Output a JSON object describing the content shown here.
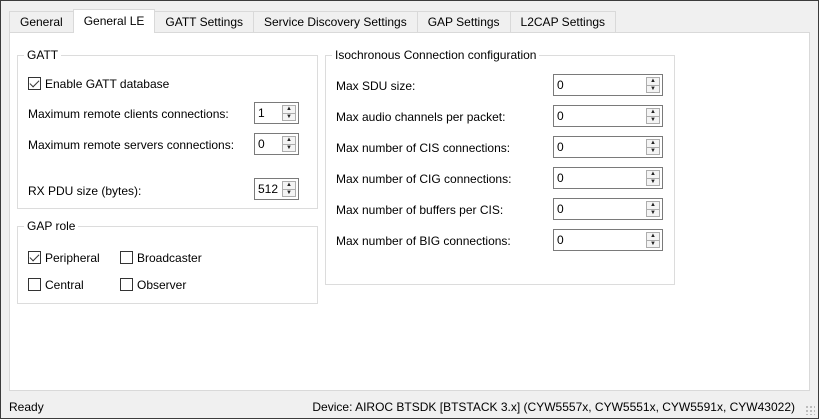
{
  "tabs": [
    {
      "label": "General"
    },
    {
      "label": "General LE"
    },
    {
      "label": "GATT Settings"
    },
    {
      "label": "Service Discovery Settings"
    },
    {
      "label": "GAP Settings"
    },
    {
      "label": "L2CAP Settings"
    }
  ],
  "gatt": {
    "legend": "GATT",
    "enable_label": "Enable GATT database",
    "enable_checked": true,
    "max_clients_label": "Maximum remote clients connections:",
    "max_clients_value": "1",
    "max_servers_label": "Maximum remote servers connections:",
    "max_servers_value": "0",
    "rx_pdu_label": "RX PDU size (bytes):",
    "rx_pdu_value": "512"
  },
  "gap_role": {
    "legend": "GAP role",
    "peripheral": {
      "label": "Peripheral",
      "checked": true
    },
    "broadcaster": {
      "label": "Broadcaster",
      "checked": false
    },
    "central": {
      "label": "Central",
      "checked": false
    },
    "observer": {
      "label": "Observer",
      "checked": false
    }
  },
  "iso": {
    "legend": "Isochronous Connection configuration",
    "fields": [
      {
        "label": "Max SDU size:",
        "value": "0"
      },
      {
        "label": "Max audio channels per packet:",
        "value": "0"
      },
      {
        "label": "Max number of CIS connections:",
        "value": "0"
      },
      {
        "label": "Max number of CIG connections:",
        "value": "0"
      },
      {
        "label": "Max number of buffers per CIS:",
        "value": "0"
      },
      {
        "label": "Max number of BIG connections:",
        "value": "0"
      }
    ]
  },
  "status": {
    "left": "Ready",
    "right": "Device: AIROC BTSDK [BTSTACK 3.x] (CYW5557x, CYW5551x, CYW5591x, CYW43022)"
  }
}
